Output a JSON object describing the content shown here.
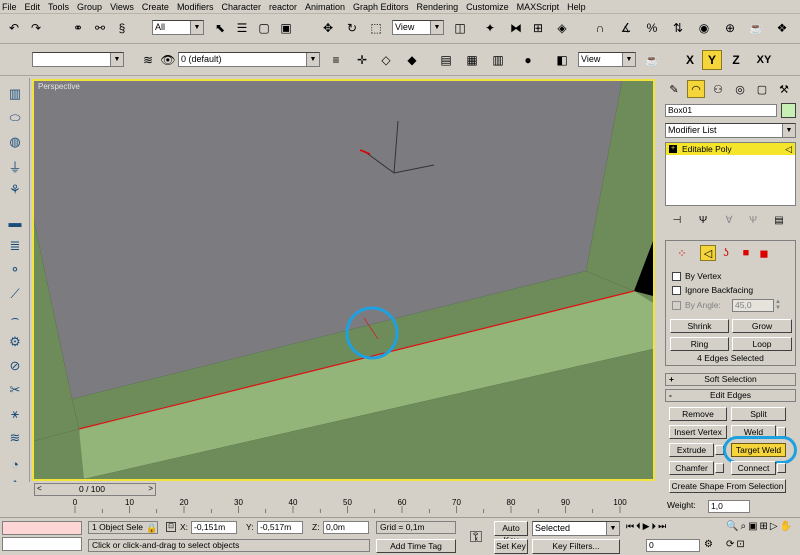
{
  "menu": [
    "File",
    "Edit",
    "Tools",
    "Group",
    "Views",
    "Create",
    "Modifiers",
    "Character",
    "reactor",
    "Animation",
    "Graph Editors",
    "Rendering",
    "Customize",
    "MAXScript",
    "Help"
  ],
  "toolbar1": {
    "selection_filter": "All",
    "coord_system": "View",
    "icon_names": [
      "undo-icon",
      "redo-icon",
      "select-link-icon",
      "unlink-icon",
      "bind-spacewarp-icon",
      "select-icon",
      "select-by-name-icon",
      "rect-region-icon",
      "window-crossing-icon",
      "move-icon",
      "rotate-icon",
      "scale-icon",
      "pivot-icon",
      "mirror-icon",
      "align-icon",
      "snap-icon",
      "angle-snap-icon",
      "percent-snap-icon",
      "spinner-snap-icon",
      "xy-icon"
    ]
  },
  "toolbar2": {
    "layer": "0 (default)",
    "named_selection": "",
    "view": "View",
    "axis_x": "X",
    "axis_y": "Y",
    "axis_z": "Z",
    "axis_xy": "XY"
  },
  "viewport": {
    "label": "Perspective",
    "colors": {
      "gray": "#7c7c80",
      "green": "#6e8c5a",
      "light_green": "#93b57a",
      "highlight": "#1da1e0",
      "edge": "#e01010"
    }
  },
  "panel": {
    "object_name": "Box01",
    "color_swatch": "#c8f0b4",
    "modifier_list": "Modifier List",
    "stack_item": "Editable Poly",
    "by_vertex": "By Vertex",
    "ignore_backfacing": "Ignore Backfacing",
    "by_angle": "By Angle:",
    "by_angle_value": "45,0",
    "shrink": "Shrink",
    "grow": "Grow",
    "ring": "Ring",
    "loop": "Loop",
    "selection_info": "4 Edges Selected",
    "soft_selection": "Soft Selection",
    "edit_edges": "Edit Edges",
    "remove": "Remove",
    "split": "Split",
    "insert_vertex": "Insert Vertex",
    "weld": "Weld",
    "extrude": "Extrude",
    "target_weld": "Target Weld",
    "chamfer": "Chamfer",
    "connect": "Connect",
    "create_shape": "Create Shape From Selection",
    "weight_label": "Weight:",
    "weight_value": "1,0"
  },
  "timeline": {
    "frame": "0 / 100",
    "ticks": [
      "0",
      "10",
      "20",
      "30",
      "40",
      "50",
      "60",
      "70",
      "80",
      "90",
      "100"
    ]
  },
  "status": {
    "object_selected": "1 Object Sele",
    "x_label": "X:",
    "x_value": "-0,151m",
    "y_label": "Y:",
    "y_value": "-0,517m",
    "z_label": "Z:",
    "z_value": "0,0m",
    "grid": "Grid = 0,1m",
    "auto_key": "Auto Key",
    "auto_key_mode": "Selected",
    "set_key": "Set Key",
    "key_filters": "Key Filters...",
    "prompt": "Click or click-and-drag to select objects",
    "add_time_tag": "Add Time Tag",
    "current_frame": "0"
  }
}
